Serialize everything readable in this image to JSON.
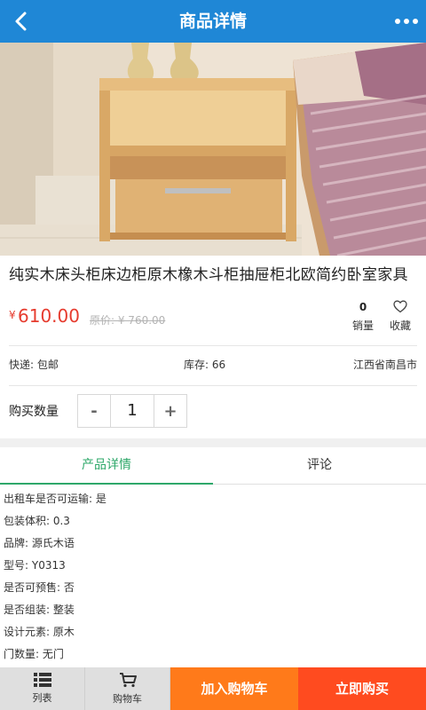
{
  "header": {
    "title": "商品详情",
    "back_icon": "chevron-left-icon",
    "more_icon": "more-horizontal-icon"
  },
  "product": {
    "name": "纯实木床头柜床边柜原木橡木斗柜抽屉柜北欧简约卧室家具",
    "currency_symbol": "¥",
    "price": "610.00",
    "original_price": "原价: ¥ 760.00",
    "sales_count": "0",
    "sales_label": "销量",
    "favorite_label": "收藏"
  },
  "info": {
    "shipping": "快递: 包邮",
    "stock": "库存: 66",
    "location": "江西省南昌市"
  },
  "quantity": {
    "label": "购买数量",
    "minus": "-",
    "value": "1",
    "plus": "+"
  },
  "tabs": [
    {
      "label": "产品详情",
      "active": true
    },
    {
      "label": "评论",
      "active": false
    }
  ],
  "specs": [
    "出租车是否可运输: 是",
    "包装体积: 0.3",
    "品牌: 源氏木语",
    "型号: Y0313",
    "是否可预售: 否",
    "是否组装: 整装",
    "设计元素: 原木",
    "门数量: 无门"
  ],
  "bottom_bar": {
    "list_label": "列表",
    "cart_icon_label": "购物车",
    "add_to_cart": "加入购物车",
    "buy_now": "立即购买"
  },
  "colors": {
    "header_bg": "#1f87d6",
    "price": "#e63b2e",
    "tab_active": "#2ea86a",
    "add_to_cart_bg": "#ff7a1a",
    "buy_now_bg": "#ff4b1f"
  }
}
